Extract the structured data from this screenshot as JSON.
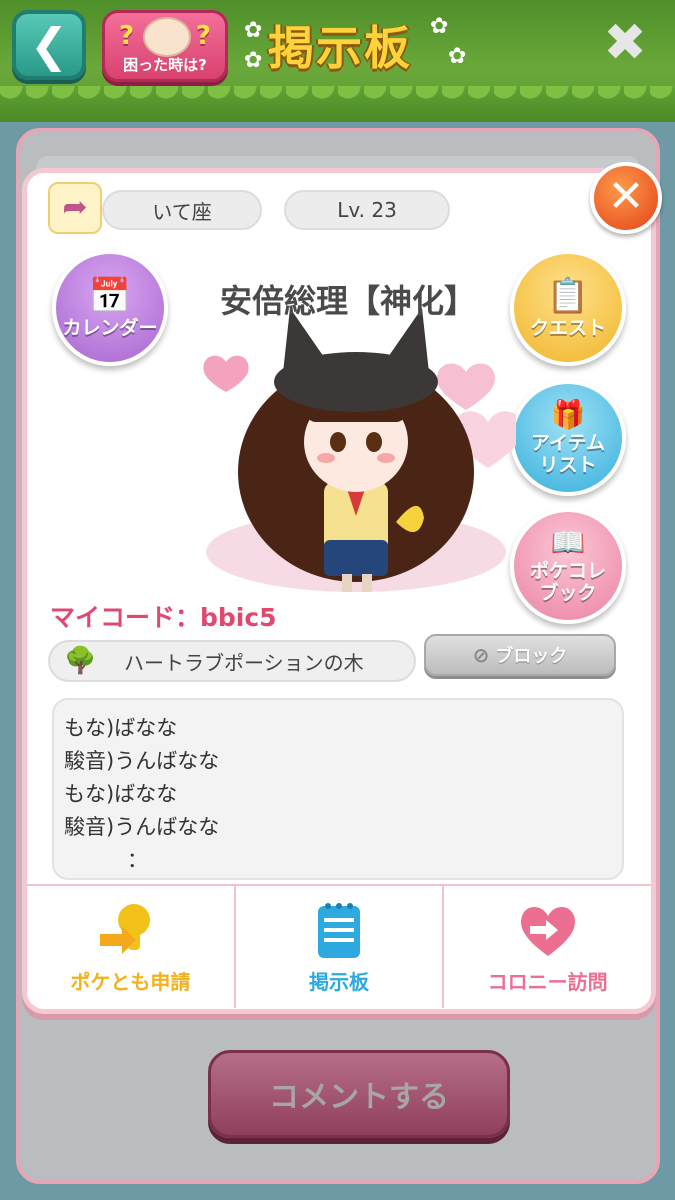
{
  "header": {
    "back_icon": "back-arrow-icon",
    "help_label": "困った時は?",
    "help_icon": "question-marks-icon",
    "title": "掲示板",
    "close_icon": "close-x-icon"
  },
  "profile": {
    "sign": "いて座",
    "sign_icon": "sagittarius-bow-icon",
    "level": "Lv. 23",
    "name": "安倍総理【神化】",
    "my_code": "マイコード：bbic5",
    "tree_label": "ハートラブポーションの木",
    "tree_icon": "tree-icon",
    "block_label": "ブロック",
    "block_icon": "prohibited-icon"
  },
  "side_buttons": {
    "calendar": {
      "label": "カレンダー",
      "icon": "calendar-icon",
      "color": "#b37ad6"
    },
    "quest": {
      "label": "クエスト",
      "icon": "clipboard-icon",
      "color": "#f5c23a"
    },
    "item_list": {
      "label_1": "アイテム",
      "label_2": "リスト",
      "icon": "gift-icon",
      "color": "#3fb7e0"
    },
    "pokecolle_book": {
      "label_1": "ポケコレ",
      "label_2": "ブック",
      "icon": "book-icon",
      "color": "#f08aa8"
    }
  },
  "message": {
    "lines": [
      "もな)ばなな",
      "駿音)うんばなな",
      "もな)ばなな",
      "駿音)うんばなな",
      "　　　："
    ]
  },
  "actions": {
    "friend_request": {
      "label": "ポケとも申請",
      "icon": "friend-key-icon",
      "color": "#f3c21a"
    },
    "board": {
      "label": "掲示板",
      "icon": "notepad-icon",
      "color": "#2ea9e0"
    },
    "colony_visit": {
      "label": "コロニー訪問",
      "icon": "visit-heart-icon",
      "color": "#ec6f92"
    }
  },
  "footer": {
    "comment_label": "コメントする"
  },
  "colors": {
    "accent_pink": "#e0486f",
    "header_green": "#5a9a30",
    "title_yellow": "#ffd339",
    "close_orange": "#e2421a"
  }
}
